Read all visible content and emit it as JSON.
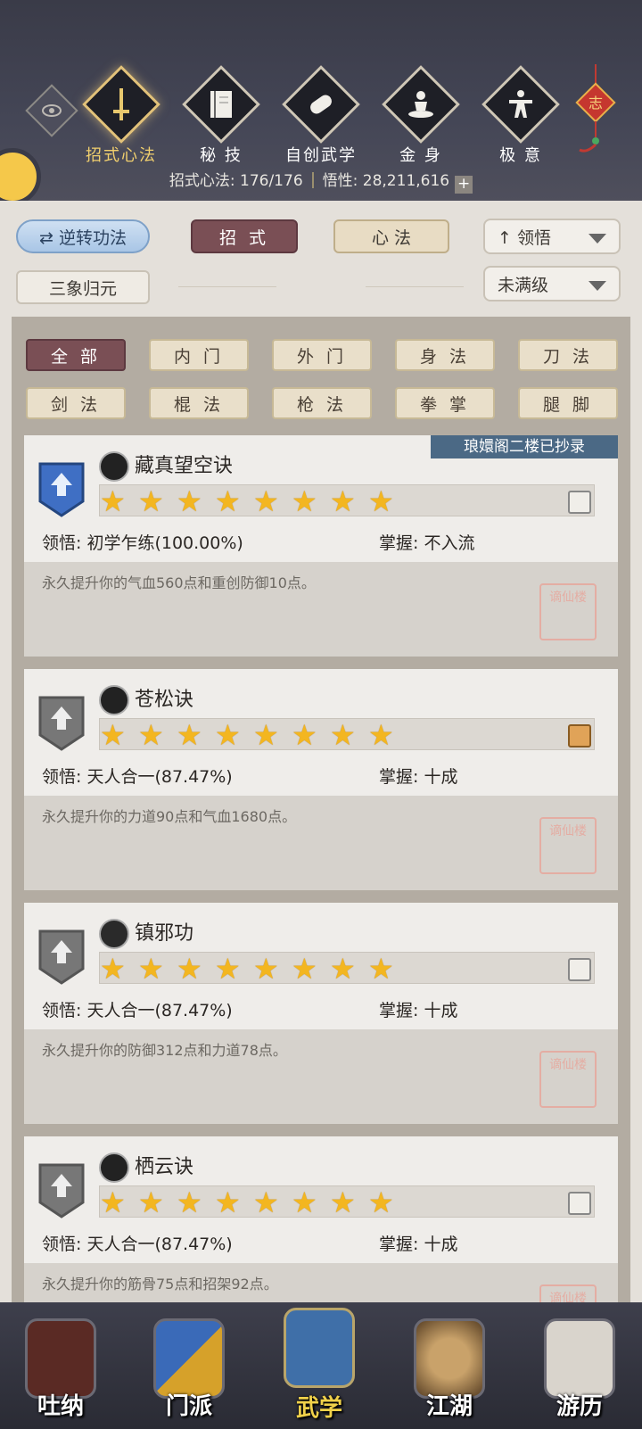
{
  "header": {
    "tabs": [
      {
        "label": "招式心法",
        "icon": "sword-icon",
        "active": true
      },
      {
        "label": "秘 技",
        "icon": "book-icon",
        "active": false
      },
      {
        "label": "自创武学",
        "icon": "scroll-icon",
        "active": false
      },
      {
        "label": "金 身",
        "icon": "meditation-icon",
        "active": false
      },
      {
        "label": "极 意",
        "icon": "martial-stance-icon",
        "active": false
      }
    ],
    "summary_label": "招式心法: 176/176",
    "insight_label": "悟性: 28,211,616",
    "plus": "+"
  },
  "controls": {
    "reverse_button": "逆转功法",
    "moves_tab": "招 式",
    "mind_tab": "心 法",
    "sort_dropdown": "领悟",
    "reset_button": "三象归元",
    "level_dropdown": "未满级"
  },
  "filters": [
    "全 部",
    "内 门",
    "外 门",
    "身 法",
    "刀 法",
    "剑 法",
    "棍 法",
    "枪 法",
    "拳 掌",
    "腿 脚"
  ],
  "active_filter": 0,
  "skills": [
    {
      "name": "藏真望空诀",
      "stars": 8,
      "comprehension": "领悟:  初学乍练(100.00%)",
      "mastery": "掌握:  不入流",
      "desc": "永久提升你的气血560点和重创防御10点。",
      "ribbon": "琅嬛阁二楼已抄录",
      "badge_color": "#3f6fc4"
    },
    {
      "name": "苍松诀",
      "stars": 8,
      "comprehension": "领悟:  天人合一(87.47%)",
      "mastery": "掌握:  十成",
      "desc": "永久提升你的力道90点和气血1680点。",
      "ribbon": "",
      "badge_color": "#777777"
    },
    {
      "name": "镇邪功",
      "stars": 8,
      "comprehension": "领悟:  天人合一(87.47%)",
      "mastery": "掌握:  十成",
      "desc": "永久提升你的防御312点和力道78点。",
      "ribbon": "",
      "badge_color": "#777777"
    },
    {
      "name": "栖云诀",
      "stars": 8,
      "comprehension": "领悟:  天人合一(87.47%)",
      "mastery": "掌握:  十成",
      "desc": "永久提升你的筋骨75点和招架92点。",
      "ribbon": "",
      "badge_color": "#777777"
    }
  ],
  "stamp_text": "谪仙楼",
  "nav": [
    {
      "label": "吐纳",
      "active": false
    },
    {
      "label": "门派",
      "active": false
    },
    {
      "label": "武学",
      "active": true
    },
    {
      "label": "江湖",
      "active": false
    },
    {
      "label": "游历",
      "active": false
    }
  ]
}
